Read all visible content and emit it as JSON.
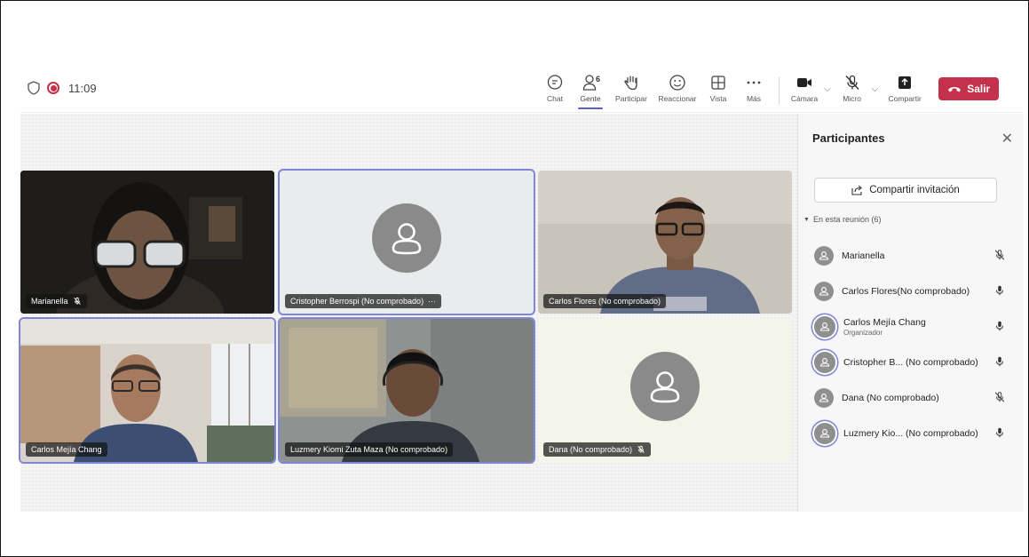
{
  "toolbar": {
    "time": "11:09",
    "tools": {
      "chat": "Chat",
      "people": "Gente",
      "people_count": "6",
      "raise": "Participar",
      "react": "Reaccionar",
      "view": "Vista",
      "more": "Más"
    },
    "devices": {
      "camera": "Cámara",
      "mic": "Micro",
      "share": "Compartir"
    },
    "leave": "Salir"
  },
  "tiles": [
    {
      "name": "Marianella",
      "muted": true
    },
    {
      "name": "Cristopher Berrospi (No comprobado)",
      "more": "···"
    },
    {
      "name": "Carlos Flores (No comprobado)"
    },
    {
      "name": "Carlos Mejía Chang"
    },
    {
      "name": "Luzmery Kiomi Zuta Maza (No comprobado)"
    },
    {
      "name": "Dana (No comprobado)",
      "muted": true
    }
  ],
  "panel": {
    "title": "Participantes",
    "invite": "Compartir invitación",
    "section": "En esta reunión (6)",
    "participants": [
      {
        "name": "Marianella",
        "role": "",
        "mic": "muted"
      },
      {
        "name": "Carlos Flores(No comprobado)",
        "role": "",
        "mic": "on"
      },
      {
        "name": "Carlos Mejía Chang",
        "role": "Organizador",
        "mic": "on"
      },
      {
        "name": "Cristopher B...  (No comprobado)",
        "role": "",
        "mic": "on"
      },
      {
        "name": "Dana (No comprobado)",
        "role": "",
        "mic": "muted"
      },
      {
        "name": "Luzmery Kio...  (No comprobado)",
        "role": "",
        "mic": "on"
      }
    ]
  },
  "colors": {
    "accent": "#5b5fc7",
    "leave": "#c4314b",
    "recording": "#c4314b"
  }
}
